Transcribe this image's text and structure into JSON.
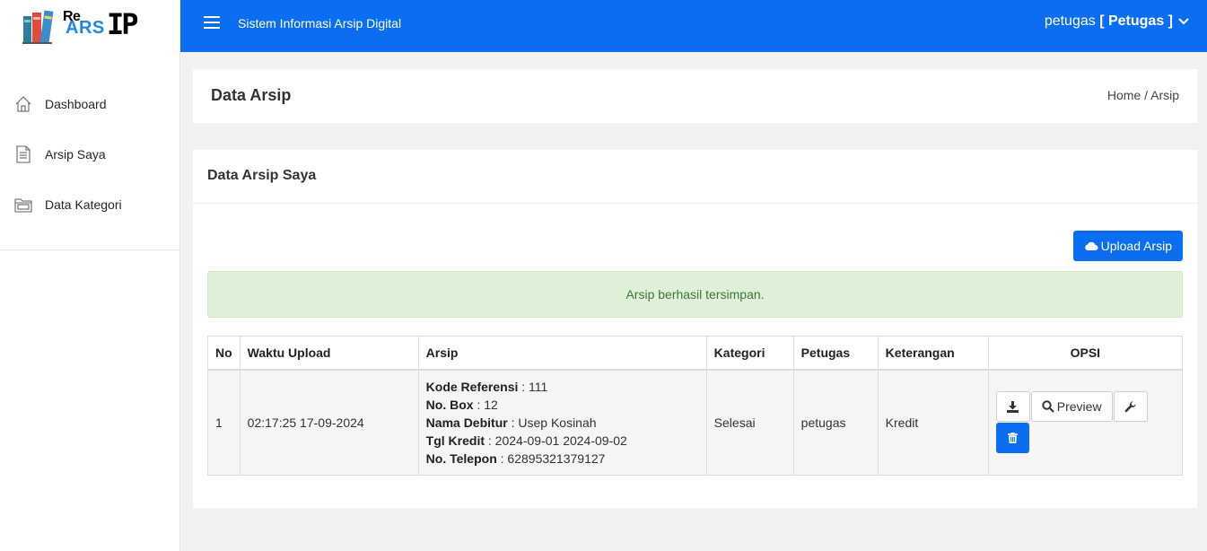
{
  "brand": {
    "re": "Re",
    "ars": "ARS",
    "ip": "IP"
  },
  "sidebar": {
    "items": [
      {
        "label": "Dashboard",
        "icon": "home-icon"
      },
      {
        "label": "Arsip Saya",
        "icon": "document-icon"
      },
      {
        "label": "Data Kategori",
        "icon": "folder-icon"
      }
    ]
  },
  "topbar": {
    "app_title": "Sistem Informasi Arsip Digital",
    "user_name": "petugas",
    "user_role": "[ Petugas ]"
  },
  "header": {
    "title": "Data Arsip",
    "breadcrumb": "Home / Arsip"
  },
  "card": {
    "title": "Data Arsip Saya",
    "upload_label": "Upload Arsip",
    "alert": "Arsip berhasil tersimpan."
  },
  "table": {
    "headers": [
      "No",
      "Waktu Upload",
      "Arsip",
      "Kategori",
      "Petugas",
      "Keterangan",
      "OPSI"
    ],
    "rows": [
      {
        "no": "1",
        "waktu": "02:17:25 17-09-2024",
        "arsip": [
          {
            "label": "Kode Referensi",
            "value": " : 111"
          },
          {
            "label": "No. Box",
            "value": " : 12"
          },
          {
            "label": "Nama Debitur",
            "value": " : Usep Kosinah"
          },
          {
            "label": "Tgl Kredit",
            "value": " : 2024-09-01 2024-09-02"
          },
          {
            "label": "No. Telepon",
            "value": " : 62895321379127"
          }
        ],
        "kategori": "Selesai",
        "petugas": "petugas",
        "keterangan": "Kredit",
        "preview_label": "Preview"
      }
    ]
  },
  "colors": {
    "primary": "#0b6ef0",
    "alert_bg": "#dff0d8",
    "alert_text": "#3c763d"
  }
}
